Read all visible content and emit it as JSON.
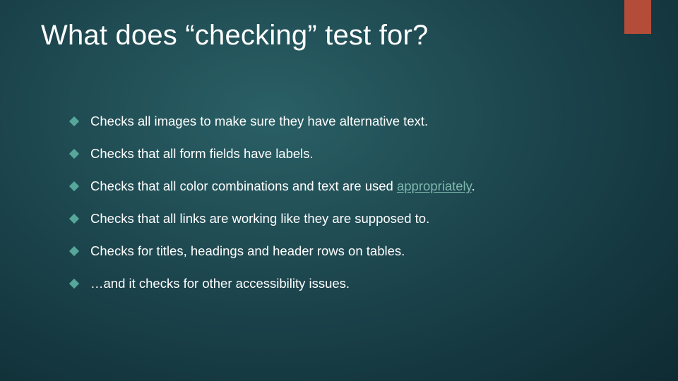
{
  "title": "What does “checking” test for?",
  "bullets": [
    {
      "plain": "Checks all images to make sure they have alternative text."
    },
    {
      "plain": "Checks that all form fields have labels."
    },
    {
      "pre": "Checks that all color combinations and text are used ",
      "hl": "appropriately",
      "post": "."
    },
    {
      "plain": "Checks that all links are working like they are supposed to."
    },
    {
      "plain": "Checks for titles, headings and header rows on tables."
    },
    {
      "plain": "…and it checks for other accessibility issues."
    }
  ]
}
